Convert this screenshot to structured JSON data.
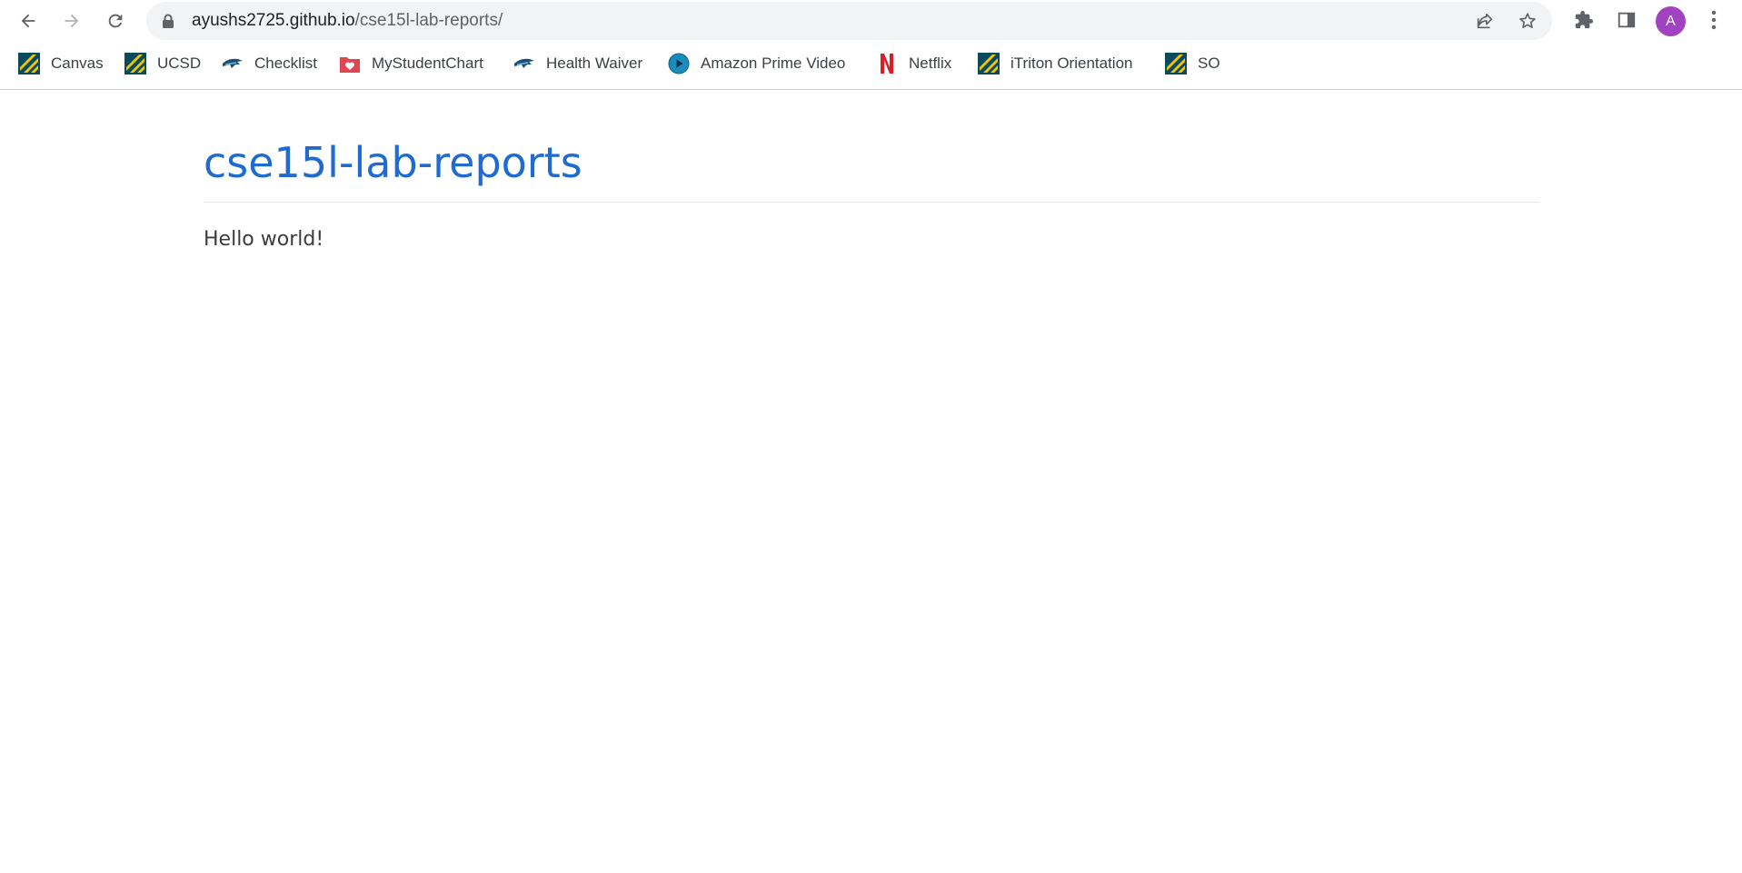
{
  "browser": {
    "url_host": "ayushs2725.github.io",
    "url_path": "/cse15l-lab-reports/",
    "profile_initial": "A",
    "accent_color": "#a142c1"
  },
  "bookmarks": [
    {
      "label": "Canvas",
      "icon": "ucsd-stripes-icon"
    },
    {
      "label": "UCSD",
      "icon": "ucsd-stripes-icon"
    },
    {
      "label": "Checklist",
      "icon": "triton-icon"
    },
    {
      "label": "MyStudentChart",
      "icon": "heart-folder-icon"
    },
    {
      "label": "Health Waiver",
      "icon": "triton-icon"
    },
    {
      "label": "Amazon Prime Video",
      "icon": "play-circle-icon"
    },
    {
      "label": "Netflix",
      "icon": "netflix-n-icon"
    },
    {
      "label": "iTriton Orientation",
      "icon": "ucsd-stripes-icon"
    },
    {
      "label": "SO",
      "icon": "ucsd-stripes-icon"
    }
  ],
  "page": {
    "title": "cse15l-lab-reports",
    "body": "Hello world!",
    "title_color": "#1f6bd1"
  }
}
